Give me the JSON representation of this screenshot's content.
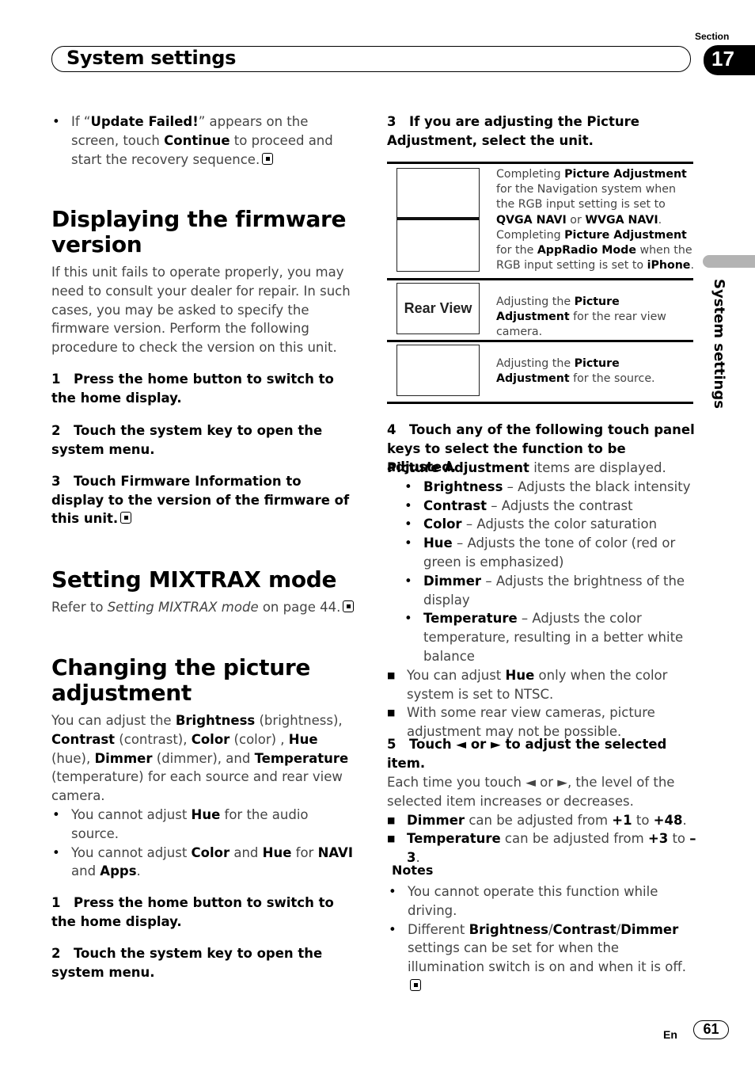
{
  "header": {
    "title": "System settings",
    "section_label": "Section",
    "section_number": "17",
    "side_tab_label": "System settings"
  },
  "left": {
    "update_failed_bullet": {
      "pre": "If “",
      "b1": "Update Failed!",
      "mid": "” appears on the screen, touch ",
      "b2": "Continue",
      "post": " to proceed and start the recovery sequence."
    },
    "firmware": {
      "heading": "Displaying the firmware version",
      "body": "If this unit fails to operate properly, you may need to consult your dealer for repair. In such cases, you may be asked to specify the firmware version. Perform the following procedure to check the version on this unit.",
      "steps": [
        "1 Press the home button to switch to the home display.",
        "2 Touch the system key to open the system menu.",
        "3 Touch Firmware Information to display to the version of the firmware of this unit."
      ]
    },
    "mixtrax": {
      "heading": "Setting MIXTRAX mode",
      "pre": "Refer to ",
      "italic": "Setting MIXTRAX mode",
      "post": " on page 44."
    },
    "picture": {
      "heading": "Changing the picture adjustment",
      "intro": [
        {
          "t": "You can adjust the ",
          "b": false
        },
        {
          "t": "Brightness",
          "b": true
        },
        {
          "t": " (brightness), ",
          "b": false
        },
        {
          "t": "Contrast",
          "b": true
        },
        {
          "t": " (contrast), ",
          "b": false
        },
        {
          "t": "Color",
          "b": true
        },
        {
          "t": " (color) , ",
          "b": false
        },
        {
          "t": "Hue",
          "b": true
        },
        {
          "t": " (hue), ",
          "b": false
        },
        {
          "t": "Dimmer",
          "b": true
        },
        {
          "t": " (dimmer), and ",
          "b": false
        },
        {
          "t": "Temperature",
          "b": true
        },
        {
          "t": " (temperature) for each source and rear view camera.",
          "b": false
        }
      ],
      "bullet1": {
        "pre": "You cannot adjust ",
        "b1": "Hue",
        "post": " for the audio source."
      },
      "bullet2": {
        "pre": "You cannot adjust ",
        "b1": "Color",
        "mid1": " and ",
        "b2": "Hue",
        "mid2": " for ",
        "b3": "NAVI",
        "mid3": " and ",
        "b4": "Apps",
        "post": "."
      },
      "steps": [
        "1 Press the home button to switch to the home display.",
        "2 Touch the system key to open the system menu."
      ]
    }
  },
  "right": {
    "step3": "3 If you are adjusting the Picture Adjustment, select the unit.",
    "table": {
      "row1": {
        "l1a": "Completing ",
        "l1b": "Picture Adjustment",
        "l2": " for the Navigation system when the RGB input setting is set to ",
        "l3a": "QVGA NAVI",
        "l3b": " or ",
        "l3c": "WVGA NAVI",
        "l3d": ".",
        "l4a": " Completing ",
        "l4b": "Picture Adjustment",
        "l5a": " for the ",
        "l5b": "AppRadio Mode",
        "l5c": " when the RGB input setting is set to ",
        "l6a": "iPhone",
        "l6b": "."
      },
      "row2": {
        "key_label": "Rear View",
        "pre": "Adjusting the ",
        "b": "Picture Adjustment",
        "post": " for the rear view camera."
      },
      "row3": {
        "pre": "Adjusting the ",
        "b": "Picture Adjustment",
        "post": " for the source."
      }
    },
    "step4": "4 Touch any of the following touch panel keys to select the function to be adjusted.",
    "step4_sub": {
      "b": "Picture Adjustment",
      "post": " items are displayed."
    },
    "items": [
      {
        "name": "Brightness",
        "desc": " – Adjusts the black intensity"
      },
      {
        "name": "Contrast",
        "desc": " – Adjusts the contrast"
      },
      {
        "name": "Color",
        "desc": " – Adjusts the color saturation"
      },
      {
        "name": "Hue",
        "desc": " – Adjusts the tone of color (red or green is emphasized)"
      },
      {
        "name": "Dimmer",
        "desc": " – Adjusts the brightness of the display"
      },
      {
        "name": "Temperature",
        "desc": " – Adjusts the color temperature, resulting in a better white balance"
      }
    ],
    "note_hue": {
      "pre": "You can adjust ",
      "b": "Hue",
      "post": " only when the color system is set to NTSC."
    },
    "note_rear": "With some rear view cameras, picture adjustment may not be possible.",
    "step5": "5 Touch ◄ or ► to adjust the selected item.",
    "step5_body": "Each time you touch ◄ or ►, the level of the selected item increases or decreases.",
    "range_dimmer": {
      "b": "Dimmer",
      "mid": " can be adjusted from ",
      "from": "+1",
      "to_word": " to ",
      "to": "+48",
      "end": "."
    },
    "range_temp": {
      "b": "Temperature",
      "mid": " can be adjusted from ",
      "from": "+3",
      "to_word": " to ",
      "to": "–3",
      "end": "."
    },
    "notes_heading": "Notes",
    "notes": {
      "n1": "You cannot operate this function while driving.",
      "n2_pre": "Different ",
      "n2_b1": "Brightness",
      "slash": "/",
      "n2_b2": "Contrast",
      "n2_b3": "Dimmer",
      "n2_post": " settings can be set for when the illumination switch is on and when it is off."
    }
  },
  "footer": {
    "lang": "En",
    "page": "61"
  }
}
